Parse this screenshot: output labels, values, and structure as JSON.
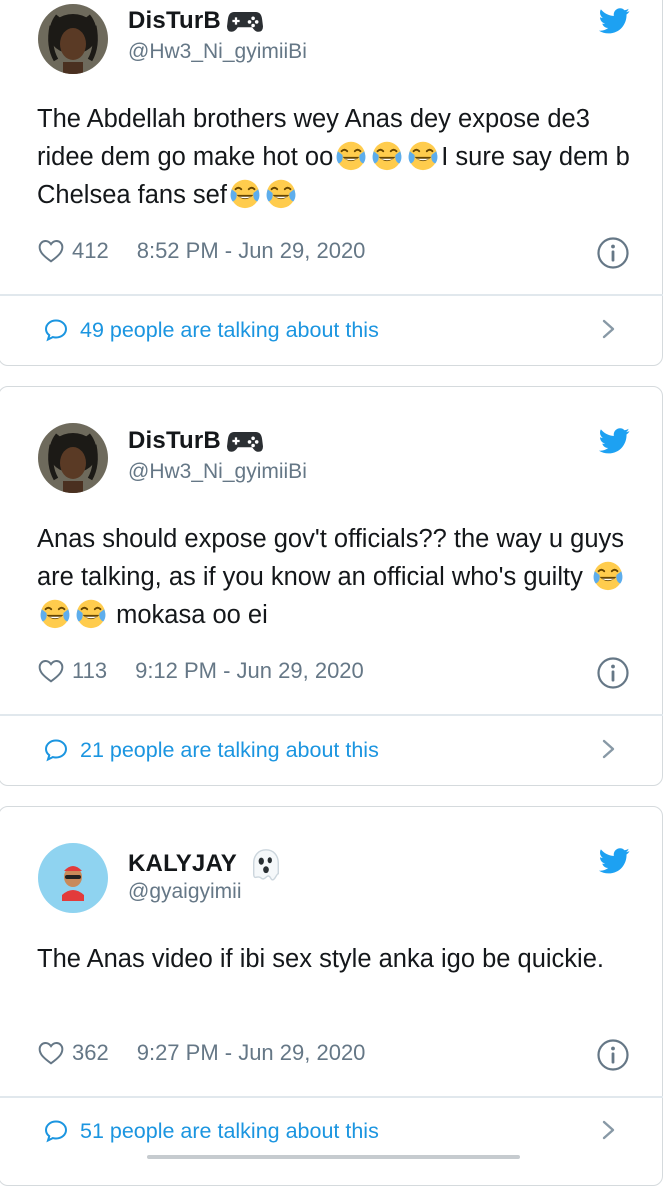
{
  "tweets": [
    {
      "name": "DisTurB",
      "name_icon": "game-controller-icon",
      "handle": "@Hw3_Ni_gyimiiBi",
      "text_parts": [
        {
          "t": "text",
          "v": "The Abdellah brothers wey Anas dey expose de3 ridee dem go make hot oo"
        },
        {
          "t": "emoji",
          "v": "laughing-tears-emoji"
        },
        {
          "t": "emoji",
          "v": "laughing-tears-emoji"
        },
        {
          "t": "emoji",
          "v": "laughing-tears-emoji"
        },
        {
          "t": "text",
          "v": "I sure say dem b Chelsea fans sef"
        },
        {
          "t": "emoji",
          "v": "laughing-tears-emoji"
        },
        {
          "t": "emoji",
          "v": "laughing-tears-emoji"
        }
      ],
      "likes": "412",
      "timestamp": "8:52 PM - Jun 29, 2020",
      "talking": "49 people are talking about this"
    },
    {
      "name": "DisTurB",
      "name_icon": "game-controller-icon",
      "handle": "@Hw3_Ni_gyimiiBi",
      "text_parts": [
        {
          "t": "text",
          "v": "Anas should expose gov't officials?? the way u guys are talking, as if you know an official who's guilty "
        },
        {
          "t": "emoji",
          "v": "laughing-tears-emoji"
        },
        {
          "t": "emoji",
          "v": "laughing-tears-emoji"
        },
        {
          "t": "emoji",
          "v": "laughing-tears-emoji"
        },
        {
          "t": "text",
          "v": " mokasa oo ei"
        }
      ],
      "likes": "113",
      "timestamp": "9:12 PM - Jun 29, 2020",
      "talking": "21 people are talking about this"
    },
    {
      "name": "KALYJAY",
      "name_icon": "ghost-icon",
      "handle": "@gyaigyimii",
      "text_parts": [
        {
          "t": "text",
          "v": "The Anas video if ibi sex style anka igo be quickie."
        }
      ],
      "likes": "362",
      "timestamp": "9:27 PM - Jun 29, 2020",
      "talking": "51 people are talking about this"
    }
  ],
  "colors": {
    "link": "#1b95e0",
    "muted": "#657786",
    "twitter_blue": "#1da1f2",
    "text": "#14171a"
  },
  "icons": {
    "like": "heart-icon",
    "info": "info-icon",
    "reply": "speech-bubble-icon",
    "chevron": "chevron-right-icon",
    "brand": "twitter-bird-icon"
  }
}
